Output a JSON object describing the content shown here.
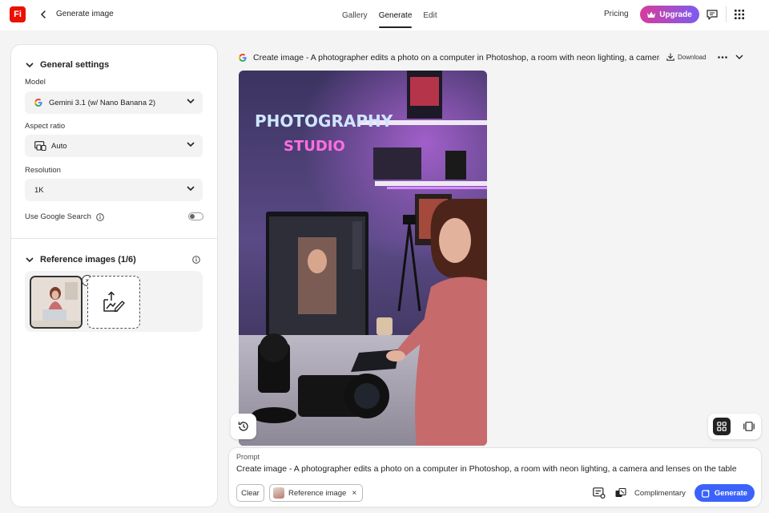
{
  "app": {
    "logo_text": "Fi",
    "page_title": "Generate image"
  },
  "nav": {
    "tabs": [
      {
        "label": "Gallery",
        "active": false
      },
      {
        "label": "Generate",
        "active": true
      },
      {
        "label": "Edit",
        "active": false
      }
    ],
    "pricing_label": "Pricing",
    "upgrade_label": "Upgrade"
  },
  "settings": {
    "section_title": "General settings",
    "model": {
      "label": "Model",
      "value": "Gemini 3.1 (w/ Nano Banana 2)"
    },
    "aspect_ratio": {
      "label": "Aspect ratio",
      "value": "Auto"
    },
    "resolution": {
      "label": "Resolution",
      "value": "1K"
    },
    "google_search": {
      "label": "Use Google Search",
      "enabled": false
    }
  },
  "reference": {
    "section_title": "Reference images (1/6)"
  },
  "result": {
    "title": "Create image - A photographer edits a photo on a computer in Photoshop, a room with neon lighting, a camera a",
    "download_label": "Download",
    "neon_line1": "PHOTOGRAPHY",
    "neon_line2": "STUDIO"
  },
  "prompt": {
    "label": "Prompt",
    "text": "Create image - A photographer edits a photo on a computer in Photoshop, a room with neon lighting, a camera and lenses on the table",
    "clear_label": "Clear",
    "reference_chip_label": "Reference image",
    "credit_label": "Complimentary",
    "generate_label": "Generate"
  },
  "colors": {
    "brand": "#eb1000",
    "generate": "#3b63fb",
    "upgrade_start": "#d73c9a",
    "upgrade_end": "#7b5cf0"
  }
}
